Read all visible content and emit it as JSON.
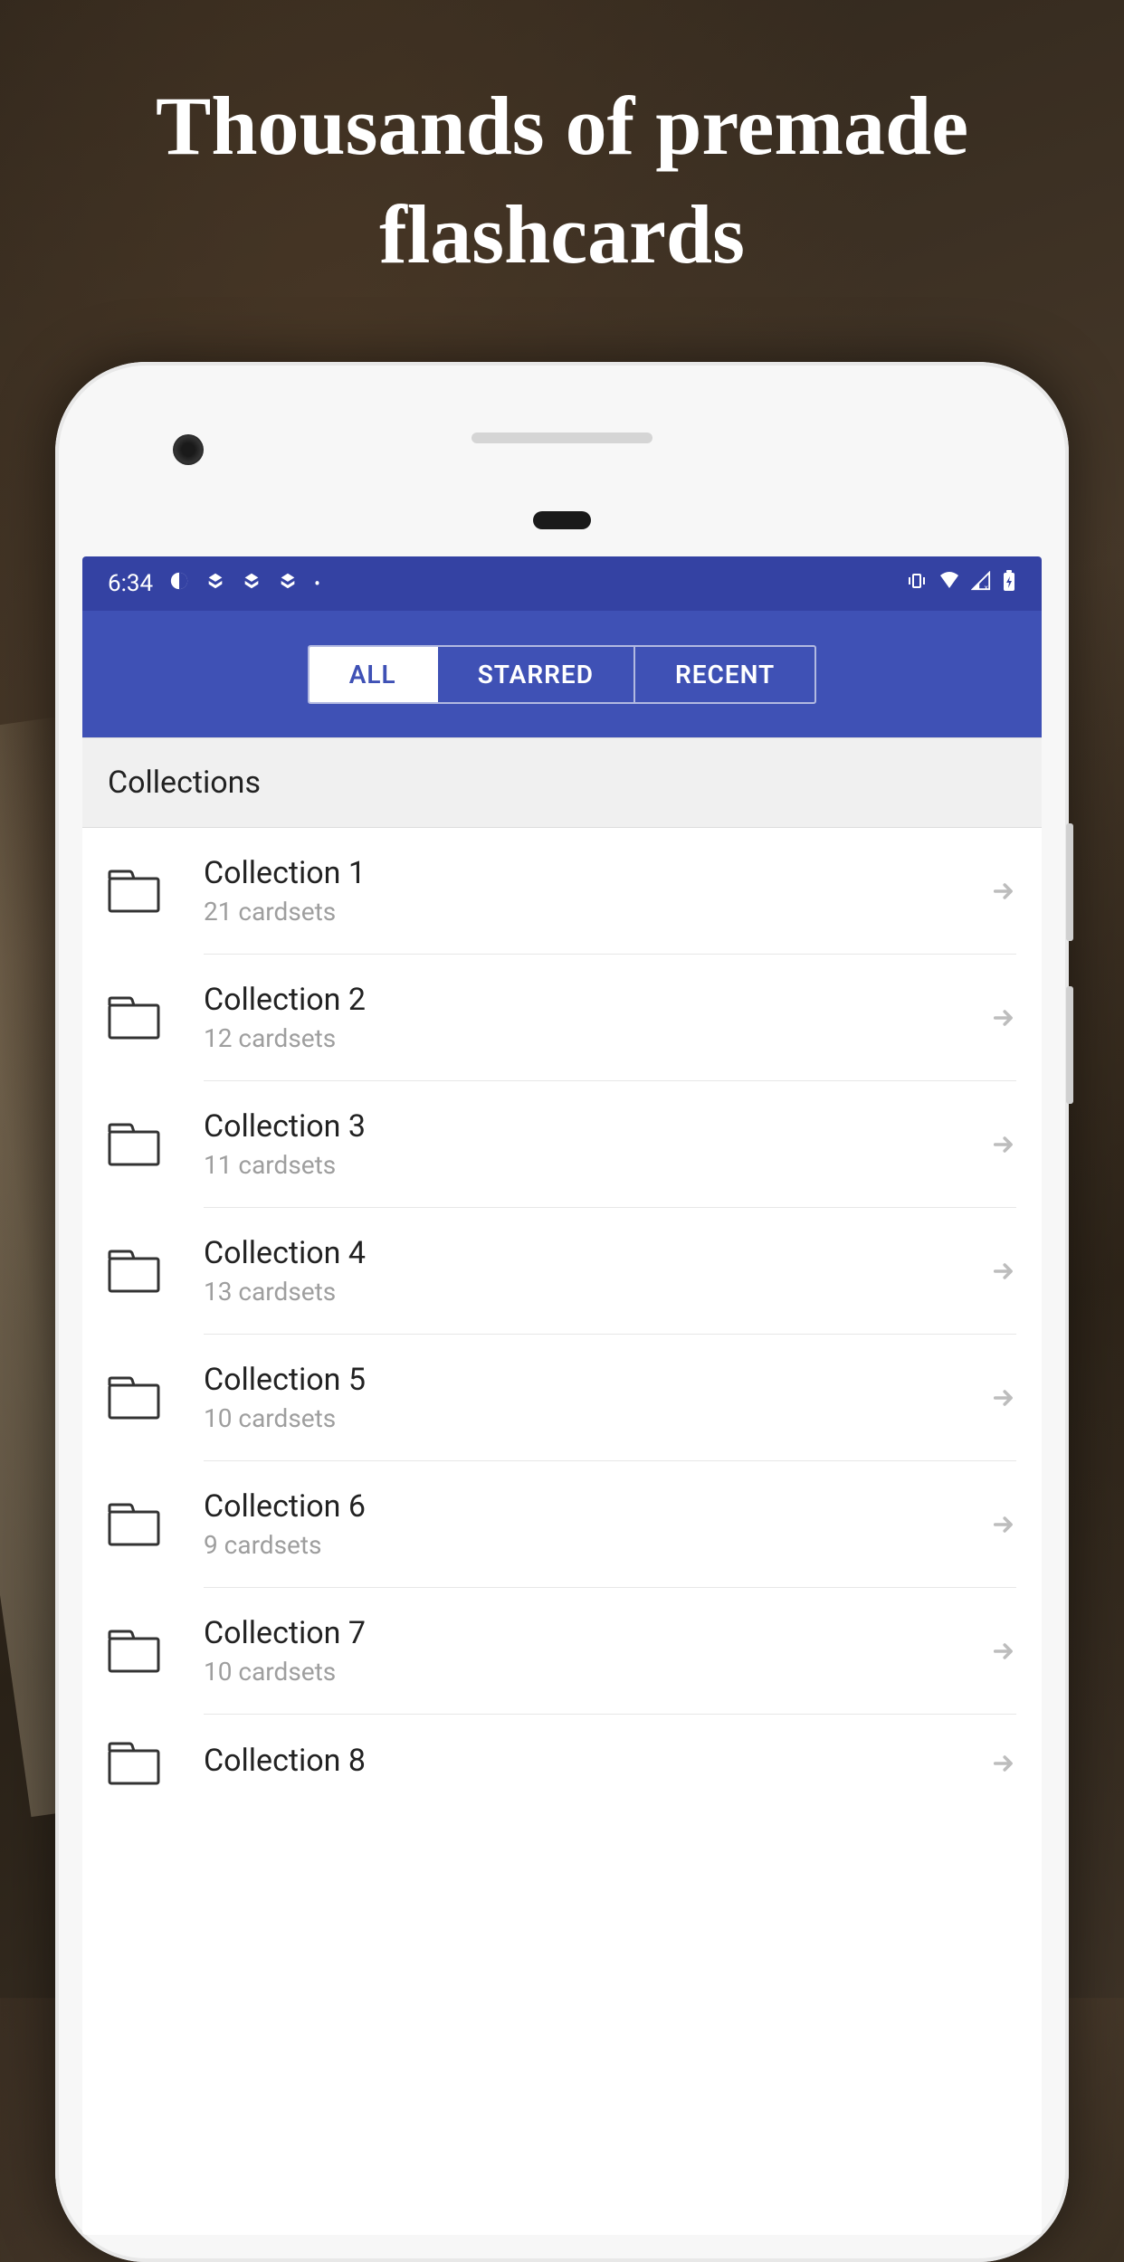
{
  "promo": {
    "headline": "Thousands of premade flashcards"
  },
  "statusbar": {
    "time": "6:34"
  },
  "tabs": [
    {
      "label": "ALL",
      "active": true
    },
    {
      "label": "STARRED",
      "active": false
    },
    {
      "label": "RECENT",
      "active": false
    }
  ],
  "section": {
    "title": "Collections"
  },
  "collections": [
    {
      "name": "Collection 1",
      "subtitle": "21 cardsets"
    },
    {
      "name": "Collection 2",
      "subtitle": "12 cardsets"
    },
    {
      "name": "Collection 3",
      "subtitle": "11 cardsets"
    },
    {
      "name": "Collection 4",
      "subtitle": "13 cardsets"
    },
    {
      "name": "Collection 5",
      "subtitle": "10 cardsets"
    },
    {
      "name": "Collection 6",
      "subtitle": "9 cardsets"
    },
    {
      "name": "Collection 7",
      "subtitle": "10 cardsets"
    },
    {
      "name": "Collection 8",
      "subtitle": ""
    }
  ]
}
